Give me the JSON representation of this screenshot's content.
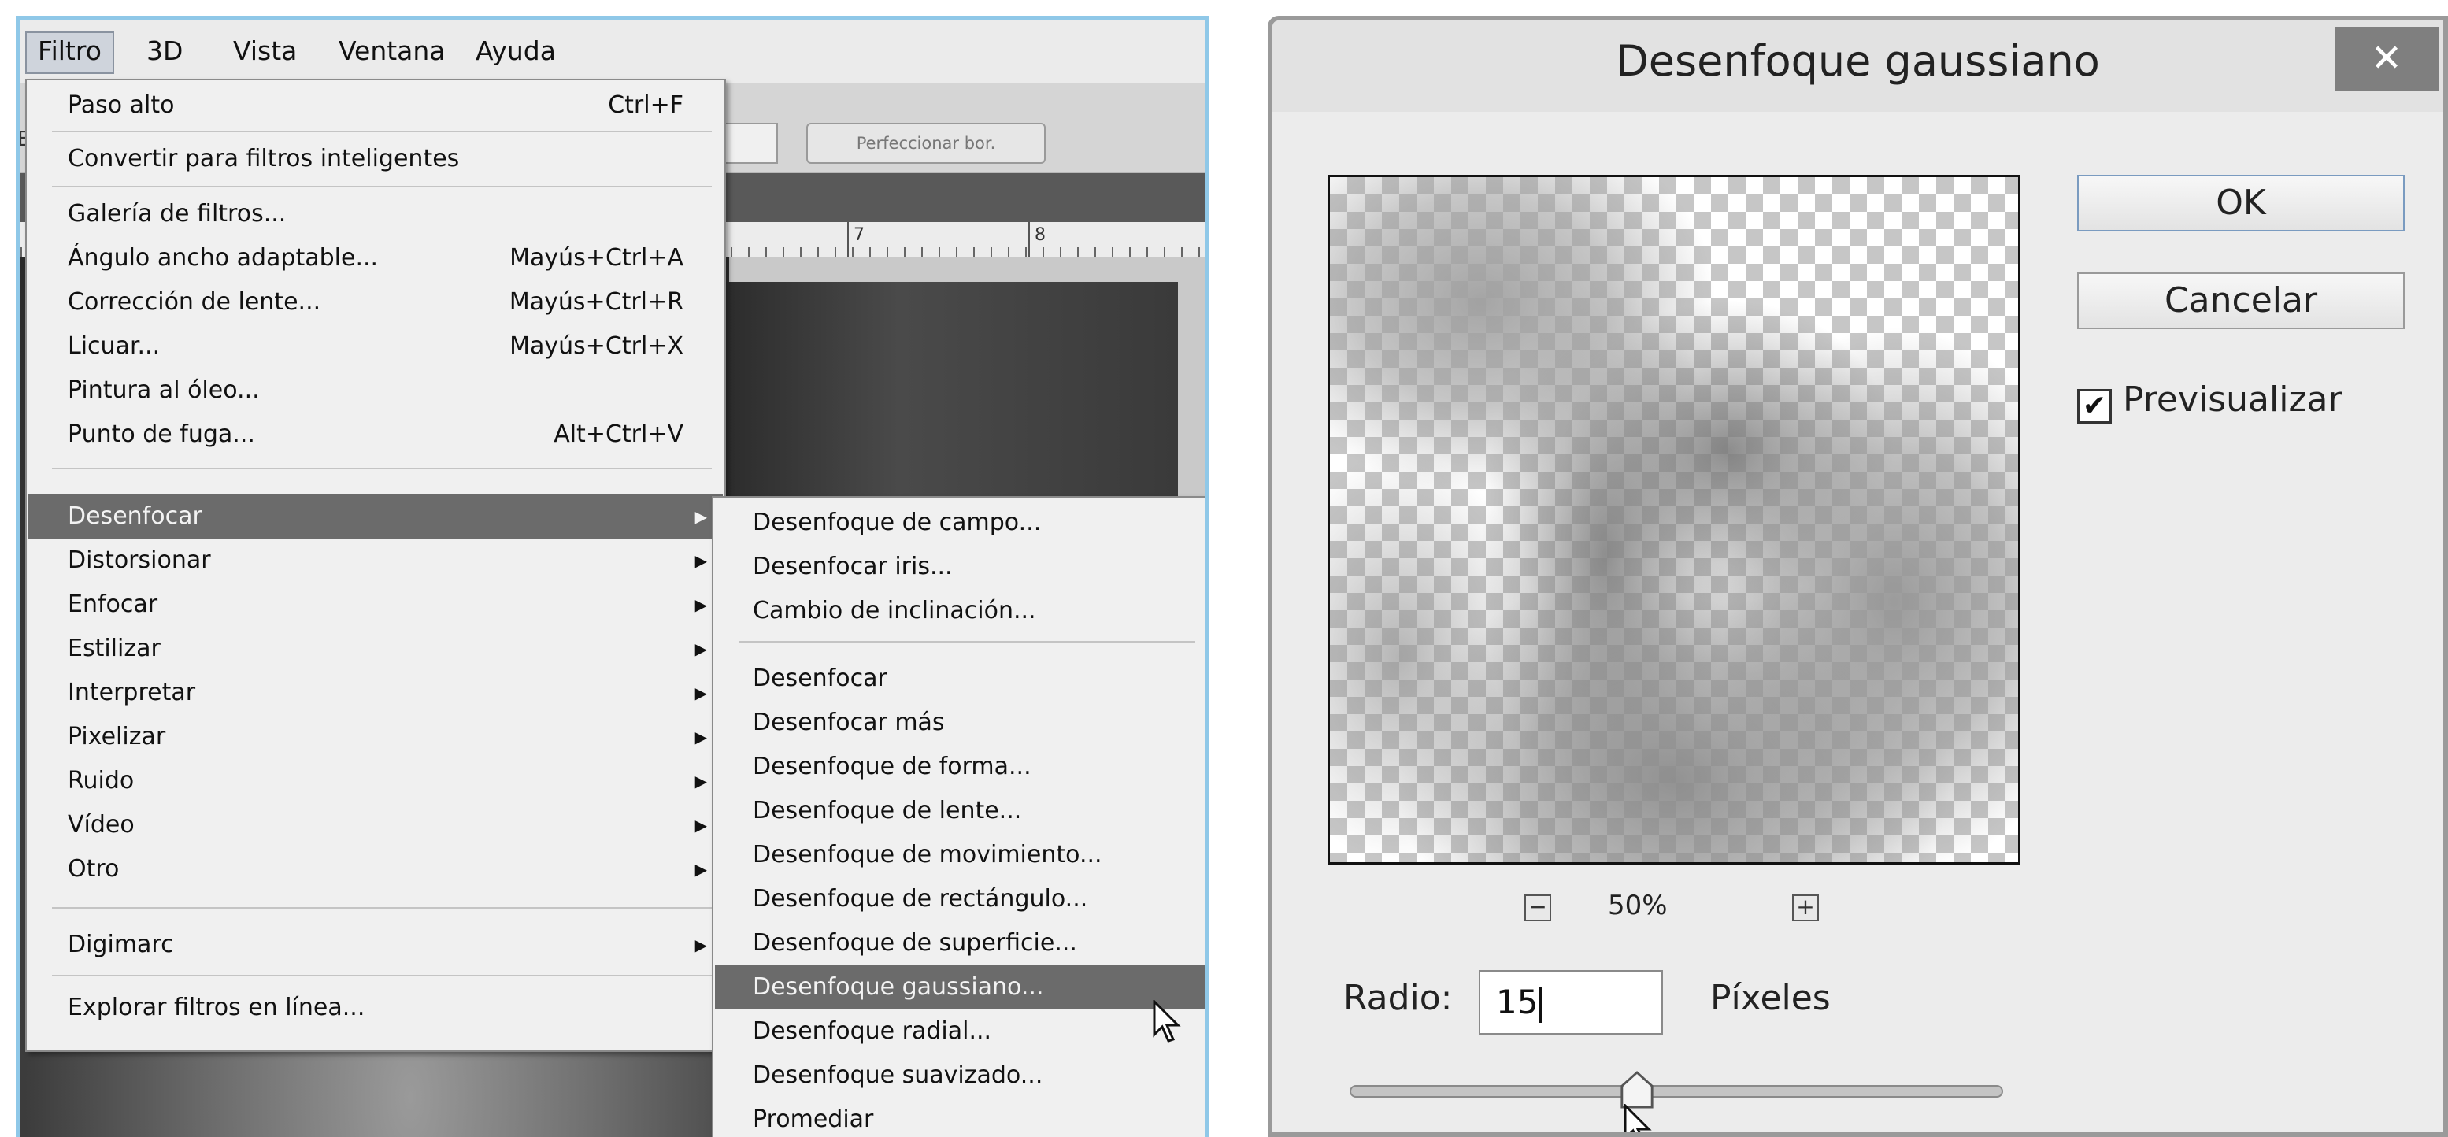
{
  "menubar": {
    "items": [
      "Filtro",
      "3D",
      "Vista",
      "Ventana",
      "Ayuda"
    ],
    "active_index": 0
  },
  "optionsbar": {
    "refine_edge_label": "Perfeccionar bor."
  },
  "ruler": {
    "labels": [
      "7",
      "8"
    ]
  },
  "filter_menu": {
    "last_filter": {
      "label": "Paso alto",
      "shortcut": "Ctrl+F"
    },
    "smart_filters": {
      "label": "Convertir para filtros inteligentes"
    },
    "items_a": [
      {
        "label": "Galería de filtros...",
        "shortcut": ""
      },
      {
        "label": "Ángulo ancho adaptable...",
        "shortcut": "Mayús+Ctrl+A"
      },
      {
        "label": "Corrección de lente...",
        "shortcut": "Mayús+Ctrl+R"
      },
      {
        "label": "Licuar...",
        "shortcut": "Mayús+Ctrl+X"
      },
      {
        "label": "Pintura al óleo...",
        "shortcut": ""
      },
      {
        "label": "Punto de fuga...",
        "shortcut": "Alt+Ctrl+V"
      }
    ],
    "items_b": [
      {
        "label": "Desenfocar",
        "submenu": true,
        "highlighted": true
      },
      {
        "label": "Distorsionar",
        "submenu": true
      },
      {
        "label": "Enfocar",
        "submenu": true
      },
      {
        "label": "Estilizar",
        "submenu": true
      },
      {
        "label": "Interpretar",
        "submenu": true
      },
      {
        "label": "Pixelizar",
        "submenu": true
      },
      {
        "label": "Ruido",
        "submenu": true
      },
      {
        "label": "Vídeo",
        "submenu": true
      },
      {
        "label": "Otro",
        "submenu": true
      }
    ],
    "digimarc": {
      "label": "Digimarc",
      "submenu": true
    },
    "browse_online": {
      "label": "Explorar filtros en línea..."
    }
  },
  "blur_submenu": {
    "group_a": [
      "Desenfoque de campo...",
      "Desenfocar iris...",
      "Cambio de inclinación..."
    ],
    "group_b": [
      "Desenfocar",
      "Desenfocar más",
      "Desenfoque de forma...",
      "Desenfoque de lente...",
      "Desenfoque de movimiento...",
      "Desenfoque de rectángulo...",
      "Desenfoque de superficie...",
      "Desenfoque gaussiano...",
      "Desenfoque radial...",
      "Desenfoque suavizado...",
      "Promediar"
    ],
    "highlighted": "Desenfoque gaussiano..."
  },
  "dialog": {
    "title": "Desenfoque gaussiano",
    "close_icon": "close-icon",
    "ok_label": "OK",
    "cancel_label": "Cancelar",
    "preview_label": "Previsualizar",
    "preview_checked": true,
    "zoom_level": "50%",
    "radius_label": "Radio:",
    "radius_value": "15",
    "units_label": "Píxeles",
    "slider_value_fraction": 0.44
  },
  "colors": {
    "menu_highlight": "#6b6b6b",
    "panel_border": "#8fc8e8",
    "close_button": "#7f7f7f"
  }
}
